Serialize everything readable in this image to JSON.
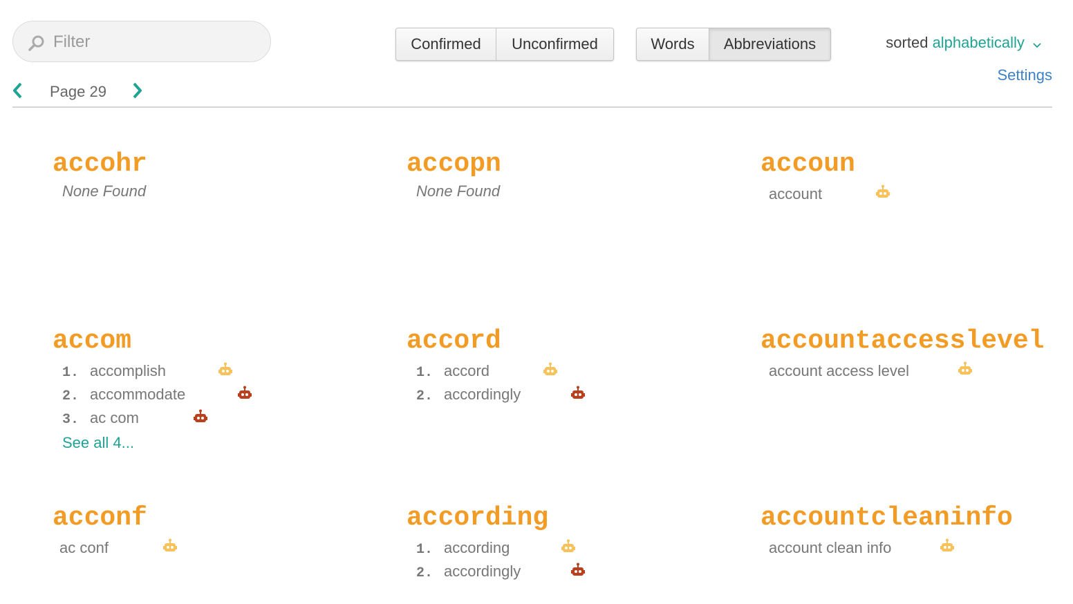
{
  "filter": {
    "placeholder": "Filter",
    "value": ""
  },
  "status_toggle": {
    "confirmed_label": "Confirmed",
    "unconfirmed_label": "Unconfirmed"
  },
  "type_toggle": {
    "words_label": "Words",
    "abbreviations_label": "Abbreviations",
    "active": "Abbreviations"
  },
  "sort": {
    "prefix": "sorted",
    "value": "alphabetically"
  },
  "settings_label": "Settings",
  "pager": {
    "label": "Page 29"
  },
  "colors": {
    "accent_teal": "#1fa394",
    "term_orange": "#f29c26",
    "robot_light": "#f5c25c",
    "robot_dark": "#b8401e",
    "link_blue": "#3f82c4"
  },
  "entries": [
    {
      "term": "accohr",
      "none_label": "None Found"
    },
    {
      "term": "accopn",
      "none_label": "None Found"
    },
    {
      "term": "accoun",
      "expansion": "account",
      "robot": "light"
    },
    {
      "term": "accom",
      "items": [
        {
          "num": "1.",
          "text": "accomplish",
          "robot": "light"
        },
        {
          "num": "2.",
          "text": "accommodate",
          "robot": "dark"
        },
        {
          "num": "3.",
          "text": "ac com",
          "robot": "dark"
        }
      ],
      "see_all": "See all 4..."
    },
    {
      "term": "accord",
      "items": [
        {
          "num": "1.",
          "text": "accord",
          "robot": "light"
        },
        {
          "num": "2.",
          "text": "accordingly",
          "robot": "dark"
        }
      ]
    },
    {
      "term": "accountaccesslevel",
      "expansion": "account access level",
      "robot": "light"
    },
    {
      "term": "acconf",
      "expansion": "ac conf",
      "robot": "light"
    },
    {
      "term": "according",
      "items": [
        {
          "num": "1.",
          "text": "according",
          "robot": "light"
        },
        {
          "num": "2.",
          "text": "accordingly",
          "robot": "dark"
        }
      ]
    },
    {
      "term": "accountcleaninfo",
      "expansion": "account clean info",
      "robot": "light"
    }
  ]
}
